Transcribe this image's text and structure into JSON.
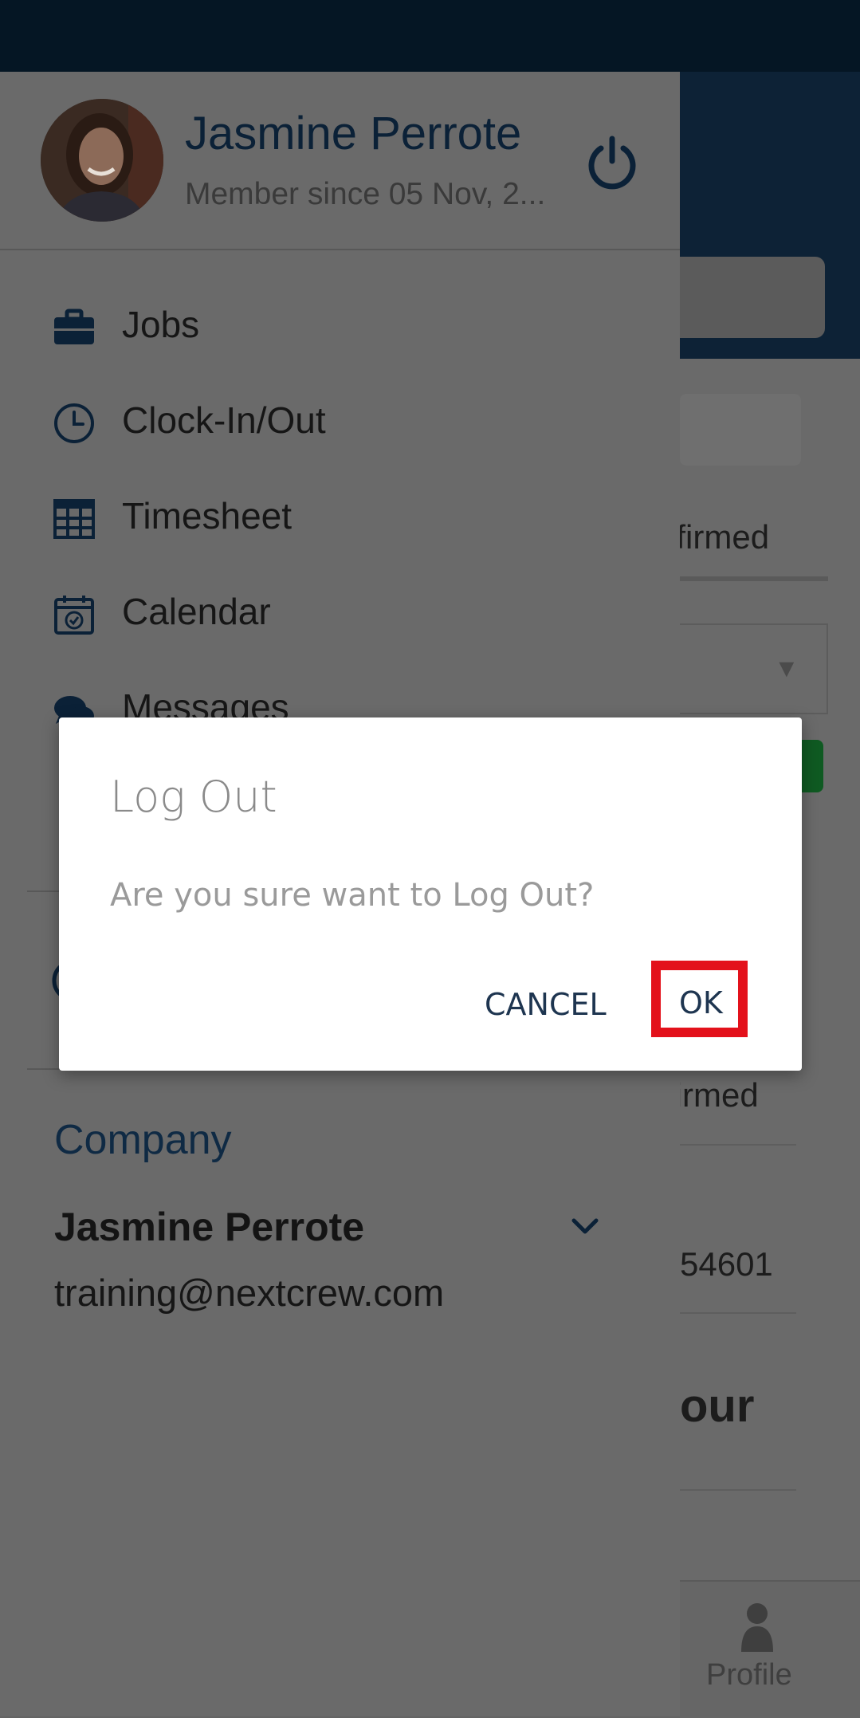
{
  "background": {
    "tab_text": "nfirmed",
    "status_text": "firmed",
    "number_text": "54601",
    "heading_text": "our",
    "bottom_nav": {
      "profile_label": "Profile",
      "profile_icon": "person-icon"
    }
  },
  "drawer": {
    "user": {
      "name": "Jasmine Perrote",
      "member_since": "Member since 05 Nov, 2..."
    },
    "power_icon": "power-icon",
    "menu": [
      {
        "label": "Jobs",
        "icon": "briefcase-icon"
      },
      {
        "label": "Clock-In/Out",
        "icon": "clock-icon"
      },
      {
        "label": "Timesheet",
        "icon": "grid-table-icon"
      },
      {
        "label": "Calendar",
        "icon": "calendar-check-icon"
      },
      {
        "label": "Messages",
        "icon": "chat-bubbles-icon"
      }
    ],
    "company": {
      "label": "Company",
      "name": "Jasmine Perrote",
      "email": "training@nextcrew.com"
    }
  },
  "dialog": {
    "title": "Log Out",
    "message": "Are you sure want to Log Out?",
    "cancel_label": "CANCEL",
    "ok_label": "OK",
    "highlight_color": "#e3111b"
  },
  "colors": {
    "status_bar": "#051624",
    "brand_dark": "#0b2137",
    "accent_green": "#0f5a22"
  }
}
